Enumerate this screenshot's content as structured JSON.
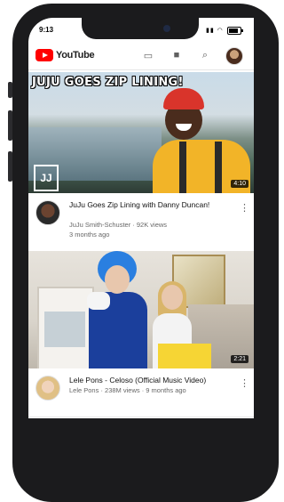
{
  "status_bar": {
    "time": "9:13"
  },
  "app": {
    "logo_text": "YouTube",
    "brand_color": "#ff0000"
  },
  "header_actions": [
    {
      "name": "cast-icon",
      "glyph": "▭"
    },
    {
      "name": "camera-icon",
      "glyph": "■"
    },
    {
      "name": "search-icon",
      "glyph": "⌕"
    }
  ],
  "videos": [
    {
      "thumbnail_caption": "JUJU GOES ZIP LINING!",
      "watermark": "JJ",
      "duration": "4:10",
      "title": "JuJu Goes Zip Lining with Danny Duncan!",
      "channel": "JuJu Smith-Schuster",
      "views": "92K views",
      "age": "3 months ago",
      "channel_meta": "JuJu Smith-Schuster · 92K views"
    },
    {
      "duration": "2:21",
      "title": "Lele Pons - Celoso (Official Music Video)",
      "channel_meta": "Lele Pons · 238M views · 9 months ago"
    }
  ],
  "tabs": [
    {
      "name": "home-tab",
      "glyph": "⌂",
      "active": true
    },
    {
      "name": "trending-tab",
      "glyph": "♨",
      "active": false
    },
    {
      "name": "subscriptions-tab",
      "glyph": "▤",
      "active": false
    },
    {
      "name": "inbox-tab",
      "glyph": "✉",
      "active": false
    },
    {
      "name": "library-tab",
      "glyph": "▰",
      "active": false
    }
  ]
}
